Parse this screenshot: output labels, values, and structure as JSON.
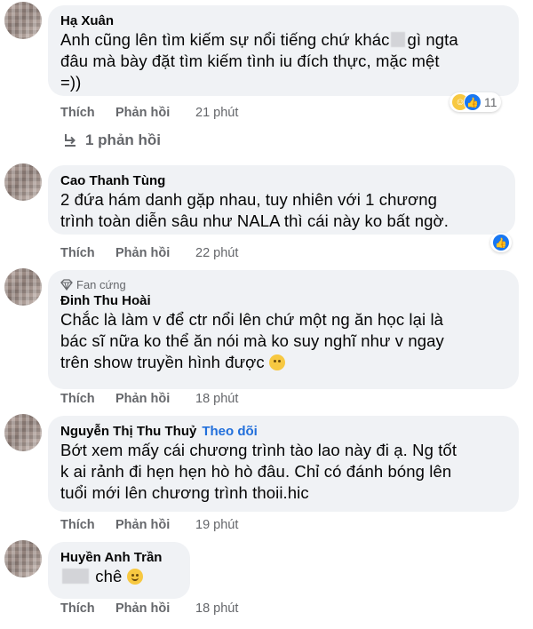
{
  "actions": {
    "like_label": "Thích",
    "reply_label": "Phản hồi"
  },
  "comments": [
    {
      "name": "Hạ Xuân",
      "text_a": "Anh cũng lên tìm kiếm sự nổi tiếng chứ khác",
      "text_b": "gì ngta",
      "text_c": "đâu mà bày đặt tìm kiếm tình iu đích thực, mặc mệt",
      "text_d": "=))",
      "time": "21 phút",
      "reaction_count": "11"
    },
    {
      "name": "Cao Thanh Tùng",
      "line1": "2 đứa hám danh gặp nhau, tuy nhiên với 1 chương",
      "line2": "trình toàn diễn sâu như NALA thì cái này ko bất ngờ.",
      "time": "22 phút"
    },
    {
      "badge": "Fan cứng",
      "name": "Đinh Thu Hoài",
      "line1": "Chắc là làm v để ctr nổi lên chứ một ng ăn học lại là",
      "line2": "bác sĩ nữa ko thể ăn nói mà ko suy nghĩ như v ngay",
      "line3": "trên show truyền hình được",
      "time": "18 phút"
    },
    {
      "name": "Nguyễn Thị Thu Thuỷ",
      "follow": "Theo dõi",
      "line1": "Bớt xem mấy cái chương trình tào lao này đi ạ. Ng tốt",
      "line2": "k ai rảnh đi hẹn hẹn hò hò đâu. Chỉ có đánh bóng lên",
      "line3": "tuổi mới lên chương trình thoii.hic",
      "time": "19 phút"
    },
    {
      "name": "Huyền Anh Trần",
      "text": "chê",
      "time": "18 phút"
    }
  ],
  "replies_link": "1 phản hồi",
  "icons": {
    "reply_arrow": "reply-arrow-icon",
    "diamond": "diamond-icon",
    "haha": "haha-reaction-icon",
    "like": "like-reaction-icon",
    "emoji_sad": "sad-face-emoji",
    "emoji_smile": "smile-emoji"
  },
  "colors": {
    "bubble": "#f0f2f5",
    "link": "#216fdb",
    "meta": "#65676b",
    "like_blue": "#1877f2"
  }
}
